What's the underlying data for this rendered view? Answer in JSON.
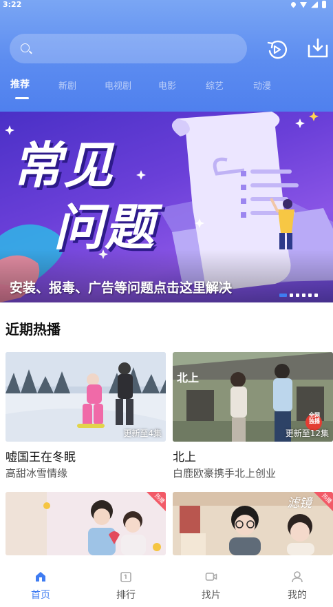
{
  "status_bar": {
    "time": "3:22"
  },
  "search": {
    "placeholder": ""
  },
  "tabs": [
    {
      "label": "推荐",
      "active": true
    },
    {
      "label": "新剧"
    },
    {
      "label": "电视剧"
    },
    {
      "label": "电影"
    },
    {
      "label": "综艺"
    },
    {
      "label": "动漫"
    }
  ],
  "banner": {
    "title_line1": "常见",
    "title_line2": "问题",
    "caption": "安装、报毒、广告等问题点击这里解决",
    "dots": 6,
    "active_dot": 0
  },
  "section": {
    "title": "近期热播"
  },
  "cards": [
    {
      "title": "嘘国王在冬眠",
      "subtitle": "高甜冰雪情缘",
      "status": "更新至4集"
    },
    {
      "title": "北上",
      "subtitle": "白鹿欧豪携手北上创业",
      "status": "更新至12集",
      "badge": "全网独播"
    },
    {
      "title": "",
      "subtitle": "",
      "status": "",
      "hot": "热播"
    },
    {
      "title": "",
      "subtitle": "",
      "status": "",
      "hot": "热播",
      "poster_text": "滤镜"
    }
  ],
  "bottom_nav": [
    {
      "label": "首页",
      "icon": "home-icon",
      "active": true
    },
    {
      "label": "排行",
      "icon": "ranking-icon"
    },
    {
      "label": "找片",
      "icon": "video-camera-icon"
    },
    {
      "label": "我的",
      "icon": "user-icon"
    }
  ],
  "colors": {
    "header_top": "#7aa6f4",
    "header_bottom": "#4f80ee",
    "accent": "#3f7cf2",
    "hot_tag": "#f25a67"
  }
}
